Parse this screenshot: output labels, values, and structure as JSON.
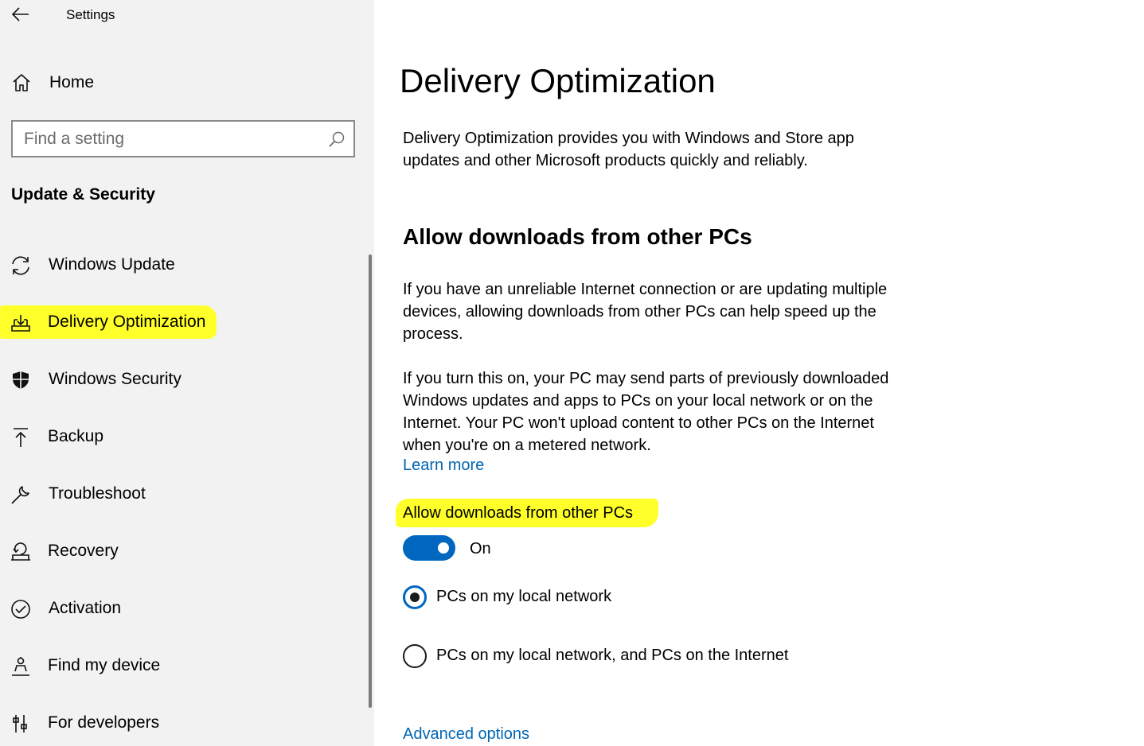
{
  "window": {
    "title": "Settings"
  },
  "sidebar": {
    "home_label": "Home",
    "search_placeholder": "Find a setting",
    "section_title": "Update & Security",
    "items": [
      {
        "label": "Windows Update",
        "icon": "sync-icon"
      },
      {
        "label": "Delivery Optimization",
        "icon": "delivery-optimization-icon",
        "selected": true
      },
      {
        "label": "Windows Security",
        "icon": "shield-icon"
      },
      {
        "label": "Backup",
        "icon": "upload-arrow-icon"
      },
      {
        "label": "Troubleshoot",
        "icon": "wrench-icon"
      },
      {
        "label": "Recovery",
        "icon": "recovery-icon"
      },
      {
        "label": "Activation",
        "icon": "check-circle-icon"
      },
      {
        "label": "Find my device",
        "icon": "person-pin-icon"
      },
      {
        "label": "For developers",
        "icon": "developer-tools-icon"
      }
    ]
  },
  "main": {
    "title": "Delivery Optimization",
    "intro_line1": "Delivery Optimization provides you with Windows and Store app",
    "intro_line2": "updates and other Microsoft products quickly and reliably.",
    "subtitle": "Allow downloads from other PCs",
    "para1_line1": "If you have an unreliable Internet connection or are updating multiple",
    "para1_line2": "devices, allowing downloads from other PCs can help speed up the",
    "para1_line3": "process.",
    "para2_line1": "If you turn this on, your PC may send parts of previously downloaded",
    "para2_line2": "Windows updates and apps to PCs on your local network or on the",
    "para2_line3": "Internet. Your PC won't upload content to other PCs on the Internet",
    "para2_line4": "when you're on a metered network.",
    "learn_more": "Learn more",
    "toggle_label": "Allow downloads from other PCs",
    "toggle_state": "On",
    "toggle_on": true,
    "radio_options": [
      {
        "label": "PCs on my local network",
        "checked": true
      },
      {
        "label": "PCs on my local network, and PCs on the Internet",
        "checked": false
      }
    ],
    "advanced_options": "Advanced options"
  },
  "colors": {
    "accent": "#0067c0",
    "link": "#0066b4",
    "highlight": "#ffff2a",
    "sidebar_bg": "#f2f2f2"
  }
}
